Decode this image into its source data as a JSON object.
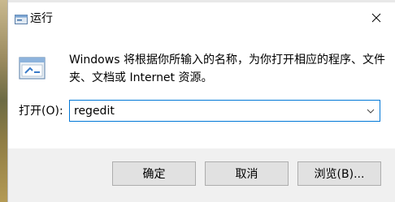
{
  "window": {
    "title": "运行",
    "close_label": "×"
  },
  "dialog": {
    "description": "Windows 将根据你所输入的名称，为你打开相应的程序、文件夹、文档或 Internet 资源。",
    "open_label": "打开(O):",
    "open_value": "regedit"
  },
  "buttons": {
    "ok": "确定",
    "cancel": "取消",
    "browse": "浏览(B)..."
  },
  "icons": {
    "title": "run-app-icon",
    "main": "run-app-icon",
    "combo": "chevron-down-icon",
    "close": "close-icon"
  },
  "colors": {
    "accent": "#0078d7",
    "footer_bg": "#f0f0f0",
    "button_bg": "#e1e1e1"
  }
}
